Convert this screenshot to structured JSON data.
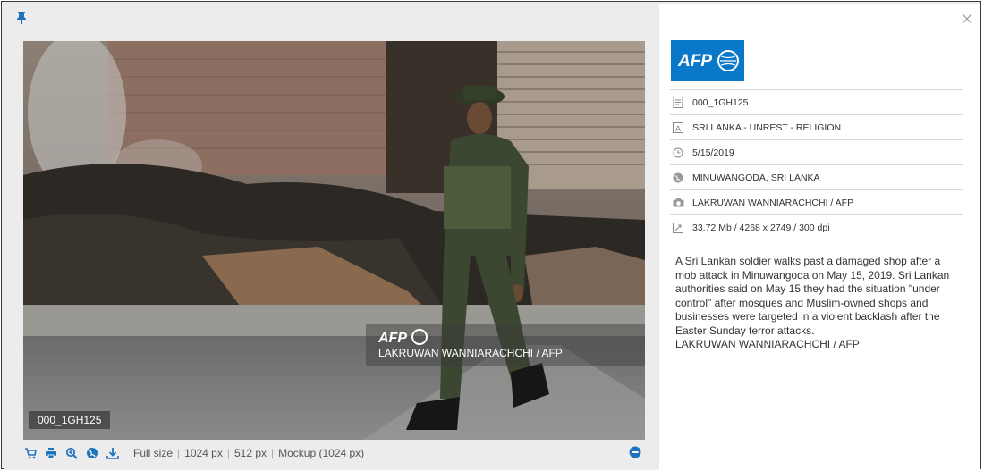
{
  "photo": {
    "id_label": "000_1GH125",
    "watermark_logo": "AFP",
    "watermark_credit": "LAKRUWAN WANNIARACHCHI / AFP"
  },
  "toolbar": {
    "icons": [
      "cart-icon",
      "print-icon",
      "zoom-in-icon",
      "globe-icon",
      "download-icon"
    ],
    "sizes": [
      "Full size",
      "1024 px",
      "512 px",
      "Mockup (1024 px)"
    ]
  },
  "info": {
    "logo": "AFP",
    "meta": [
      {
        "icon": "id-icon",
        "text": "000_1GH125"
      },
      {
        "icon": "title-icon",
        "text": "SRI LANKA - UNREST - RELIGION"
      },
      {
        "icon": "clock-icon",
        "text": "5/15/2019"
      },
      {
        "icon": "globe-icon",
        "text": "MINUWANGODA, SRI LANKA"
      },
      {
        "icon": "camera-icon",
        "text": "LAKRUWAN WANNIARACHCHI / AFP"
      },
      {
        "icon": "resize-icon",
        "text": "33.72 Mb / 4268 x 2749 / 300 dpi"
      }
    ],
    "caption": "A Sri Lankan soldier walks past a damaged shop after a mob attack in Minuwangoda on May 15, 2019. Sri Lankan authorities said on May 15 they had the situation \"under control\" after mosques and Muslim-owned shops and businesses were targeted in a violent backlash after the Easter Sunday terror attacks.",
    "caption_credit": "LAKRUWAN WANNIARACHCHI / AFP"
  },
  "colors": {
    "accent": "#1e73be",
    "afp_blue": "#0a78c8"
  }
}
